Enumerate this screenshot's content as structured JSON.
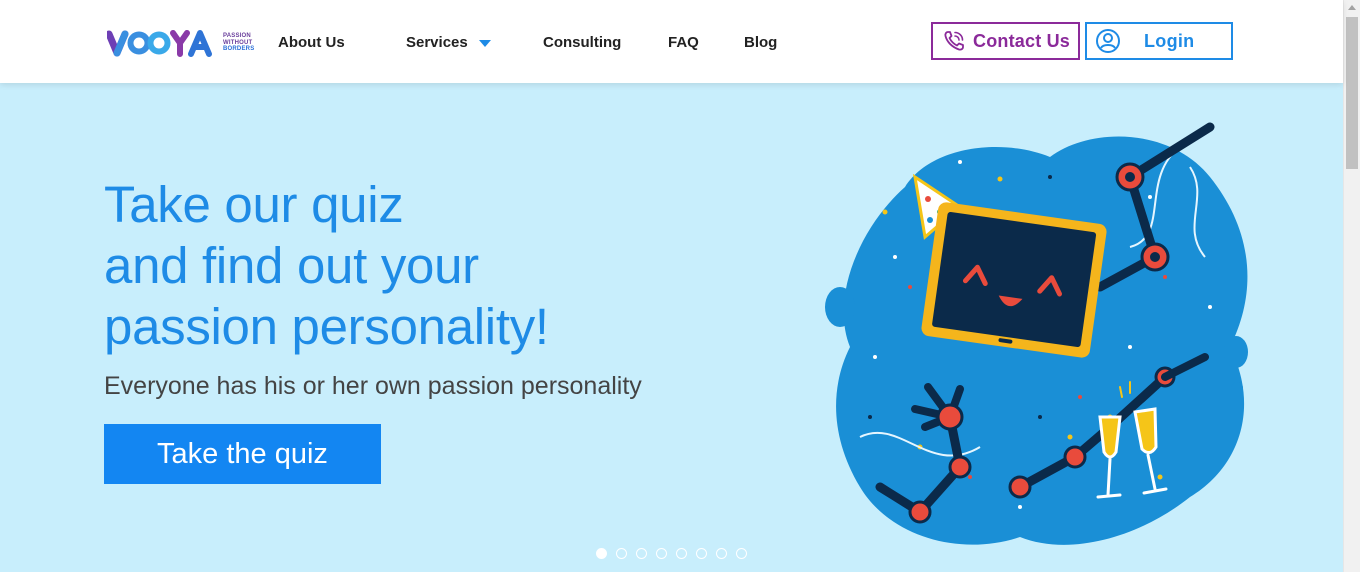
{
  "brand": {
    "name": "VOOYA",
    "tagline": [
      "PASSION",
      "WITHOUT",
      "BORDERS"
    ]
  },
  "nav": {
    "items": [
      {
        "label": "About Us"
      },
      {
        "label": "Services"
      },
      {
        "label": "Consulting"
      },
      {
        "label": "FAQ"
      },
      {
        "label": "Blog"
      }
    ],
    "contact_label": "Contact Us",
    "login_label": "Login"
  },
  "hero": {
    "title_lines": [
      "Take our quiz",
      "and find out your",
      "passion personality!"
    ],
    "subtitle": "Everyone has his or her own passion personality",
    "cta_label": "Take the quiz"
  },
  "carousel": {
    "slide_count": 8,
    "active_index": 0
  },
  "icons": {
    "services_caret": "chevron-down-icon",
    "contact": "phone-icon",
    "login": "user-circle-icon"
  },
  "colors": {
    "primary_blue": "#1e8be6",
    "contact_purple": "#8b2a9a",
    "hero_bg": "#c8eefc",
    "cta_bg": "#1386f2"
  }
}
